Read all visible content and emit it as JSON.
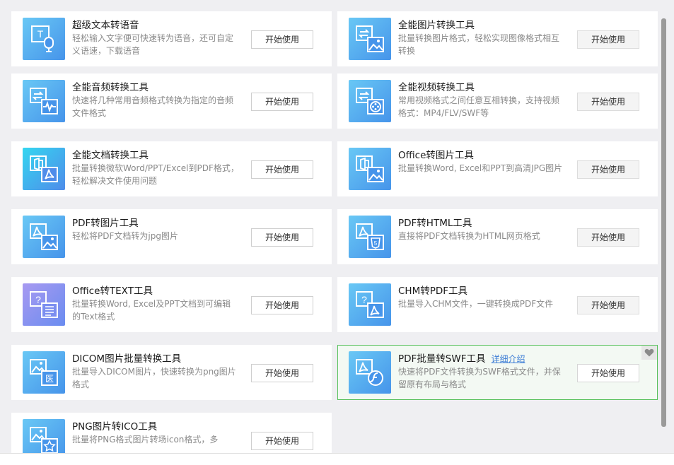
{
  "start_label": "开始使用",
  "detail_link": "详细介绍",
  "accent_colors": {
    "active_border": "#56c05a",
    "icon_blue": "#4694ea",
    "link": "#3a7bd5"
  },
  "cards": [
    {
      "title": "超级文本转语音",
      "desc": "轻松输入文字便可快速转为语音，还可自定义语速，下载语音",
      "icon": "text-to-speech-icon"
    },
    {
      "title": "全能图片转换工具",
      "desc": "批量转换图片格式，轻松实现图像格式相互转换",
      "icon": "image-convert-icon"
    },
    {
      "title": "全能音频转换工具",
      "desc": "快速将几种常用音频格式转换为指定的音频文件格式",
      "icon": "audio-convert-icon"
    },
    {
      "title": "全能视频转换工具",
      "desc": "常用视频格式之间任意互相转换，支持视频格式：MP4/FLV/SWF等",
      "icon": "video-convert-icon"
    },
    {
      "title": "全能文档转换工具",
      "desc": "批量转换微软Word/PPT/Excel到PDF格式，轻松解决文件使用问题",
      "icon": "document-convert-icon"
    },
    {
      "title": "Office转图片工具",
      "desc": "批量转换Word, Excel和PPT到高清JPG图片",
      "icon": "office-to-image-icon"
    },
    {
      "title": "PDF转图片工具",
      "desc": "轻松将PDF文档转为jpg图片",
      "icon": "pdf-to-image-icon"
    },
    {
      "title": "PDF转HTML工具",
      "desc": "直接将PDF文档转换为HTML网页格式",
      "icon": "pdf-to-html-icon"
    },
    {
      "title": "Office转TEXT工具",
      "desc": "批量转换Word, Excel及PPT文档到可编辑的Text格式",
      "icon": "office-to-text-icon"
    },
    {
      "title": "CHM转PDF工具",
      "desc": "批量导入CHM文件，一键转换成PDF文件",
      "icon": "chm-to-pdf-icon"
    },
    {
      "title": "DICOM图片批量转换工具",
      "desc": "批量导入DICOM图片，快速转换为png图片格式",
      "icon": "dicom-convert-icon"
    },
    {
      "title": "PDF批量转SWF工具",
      "desc": "快速将PDF文件转换为SWF格式文件，并保留原有布局与格式",
      "icon": "pdf-to-swf-icon"
    },
    {
      "title": "PNG图片转ICO工具",
      "desc": "批量将PNG格式图片转场icon格式，多",
      "icon": "png-to-ico-icon"
    }
  ]
}
